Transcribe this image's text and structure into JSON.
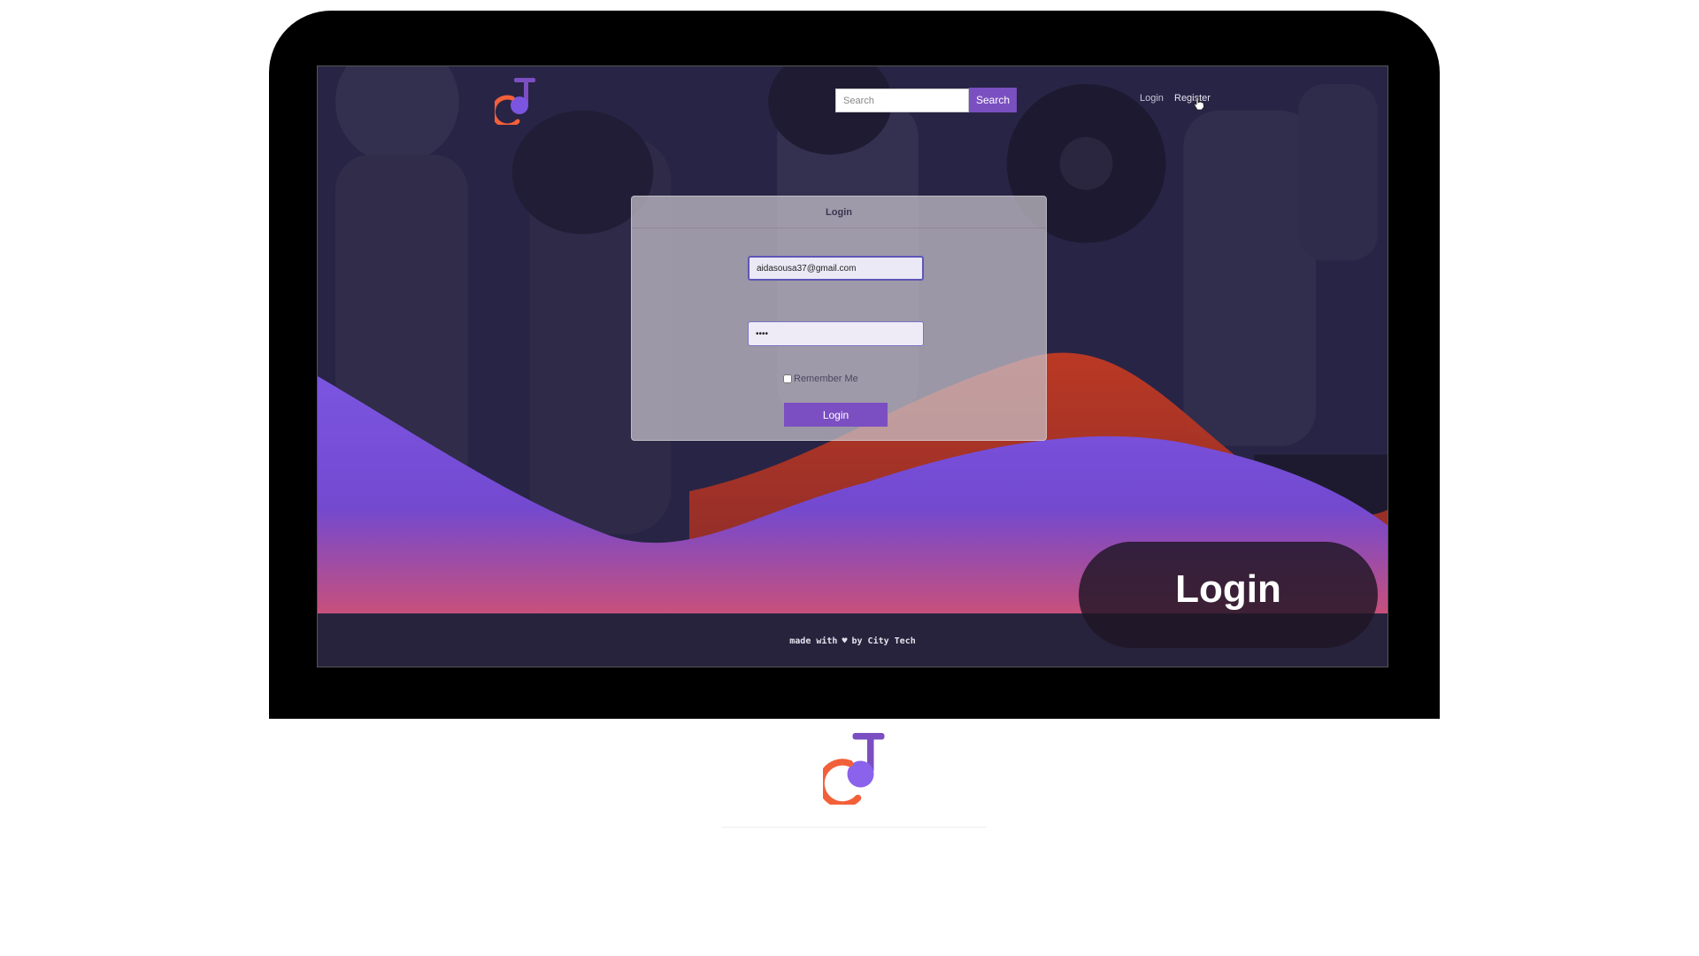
{
  "navbar": {
    "search_placeholder": "Search",
    "search_button": "Search",
    "login_link": "Login",
    "register_link": "Register"
  },
  "login_panel": {
    "title": "Login",
    "email_value": "aidasousa37@gmail.com",
    "password_value": "••••",
    "remember_label": "Remember Me",
    "submit_label": "Login"
  },
  "footer": {
    "text_before": "made with",
    "heart_icon": "♥",
    "text_after": "by City Tech"
  },
  "overlay": {
    "label": "Login"
  },
  "colors": {
    "accent_purple": "#7a4fc0",
    "logo_orange": "#f2603a",
    "logo_purple": "#7b55e0",
    "wave_red": "#c43a22"
  }
}
